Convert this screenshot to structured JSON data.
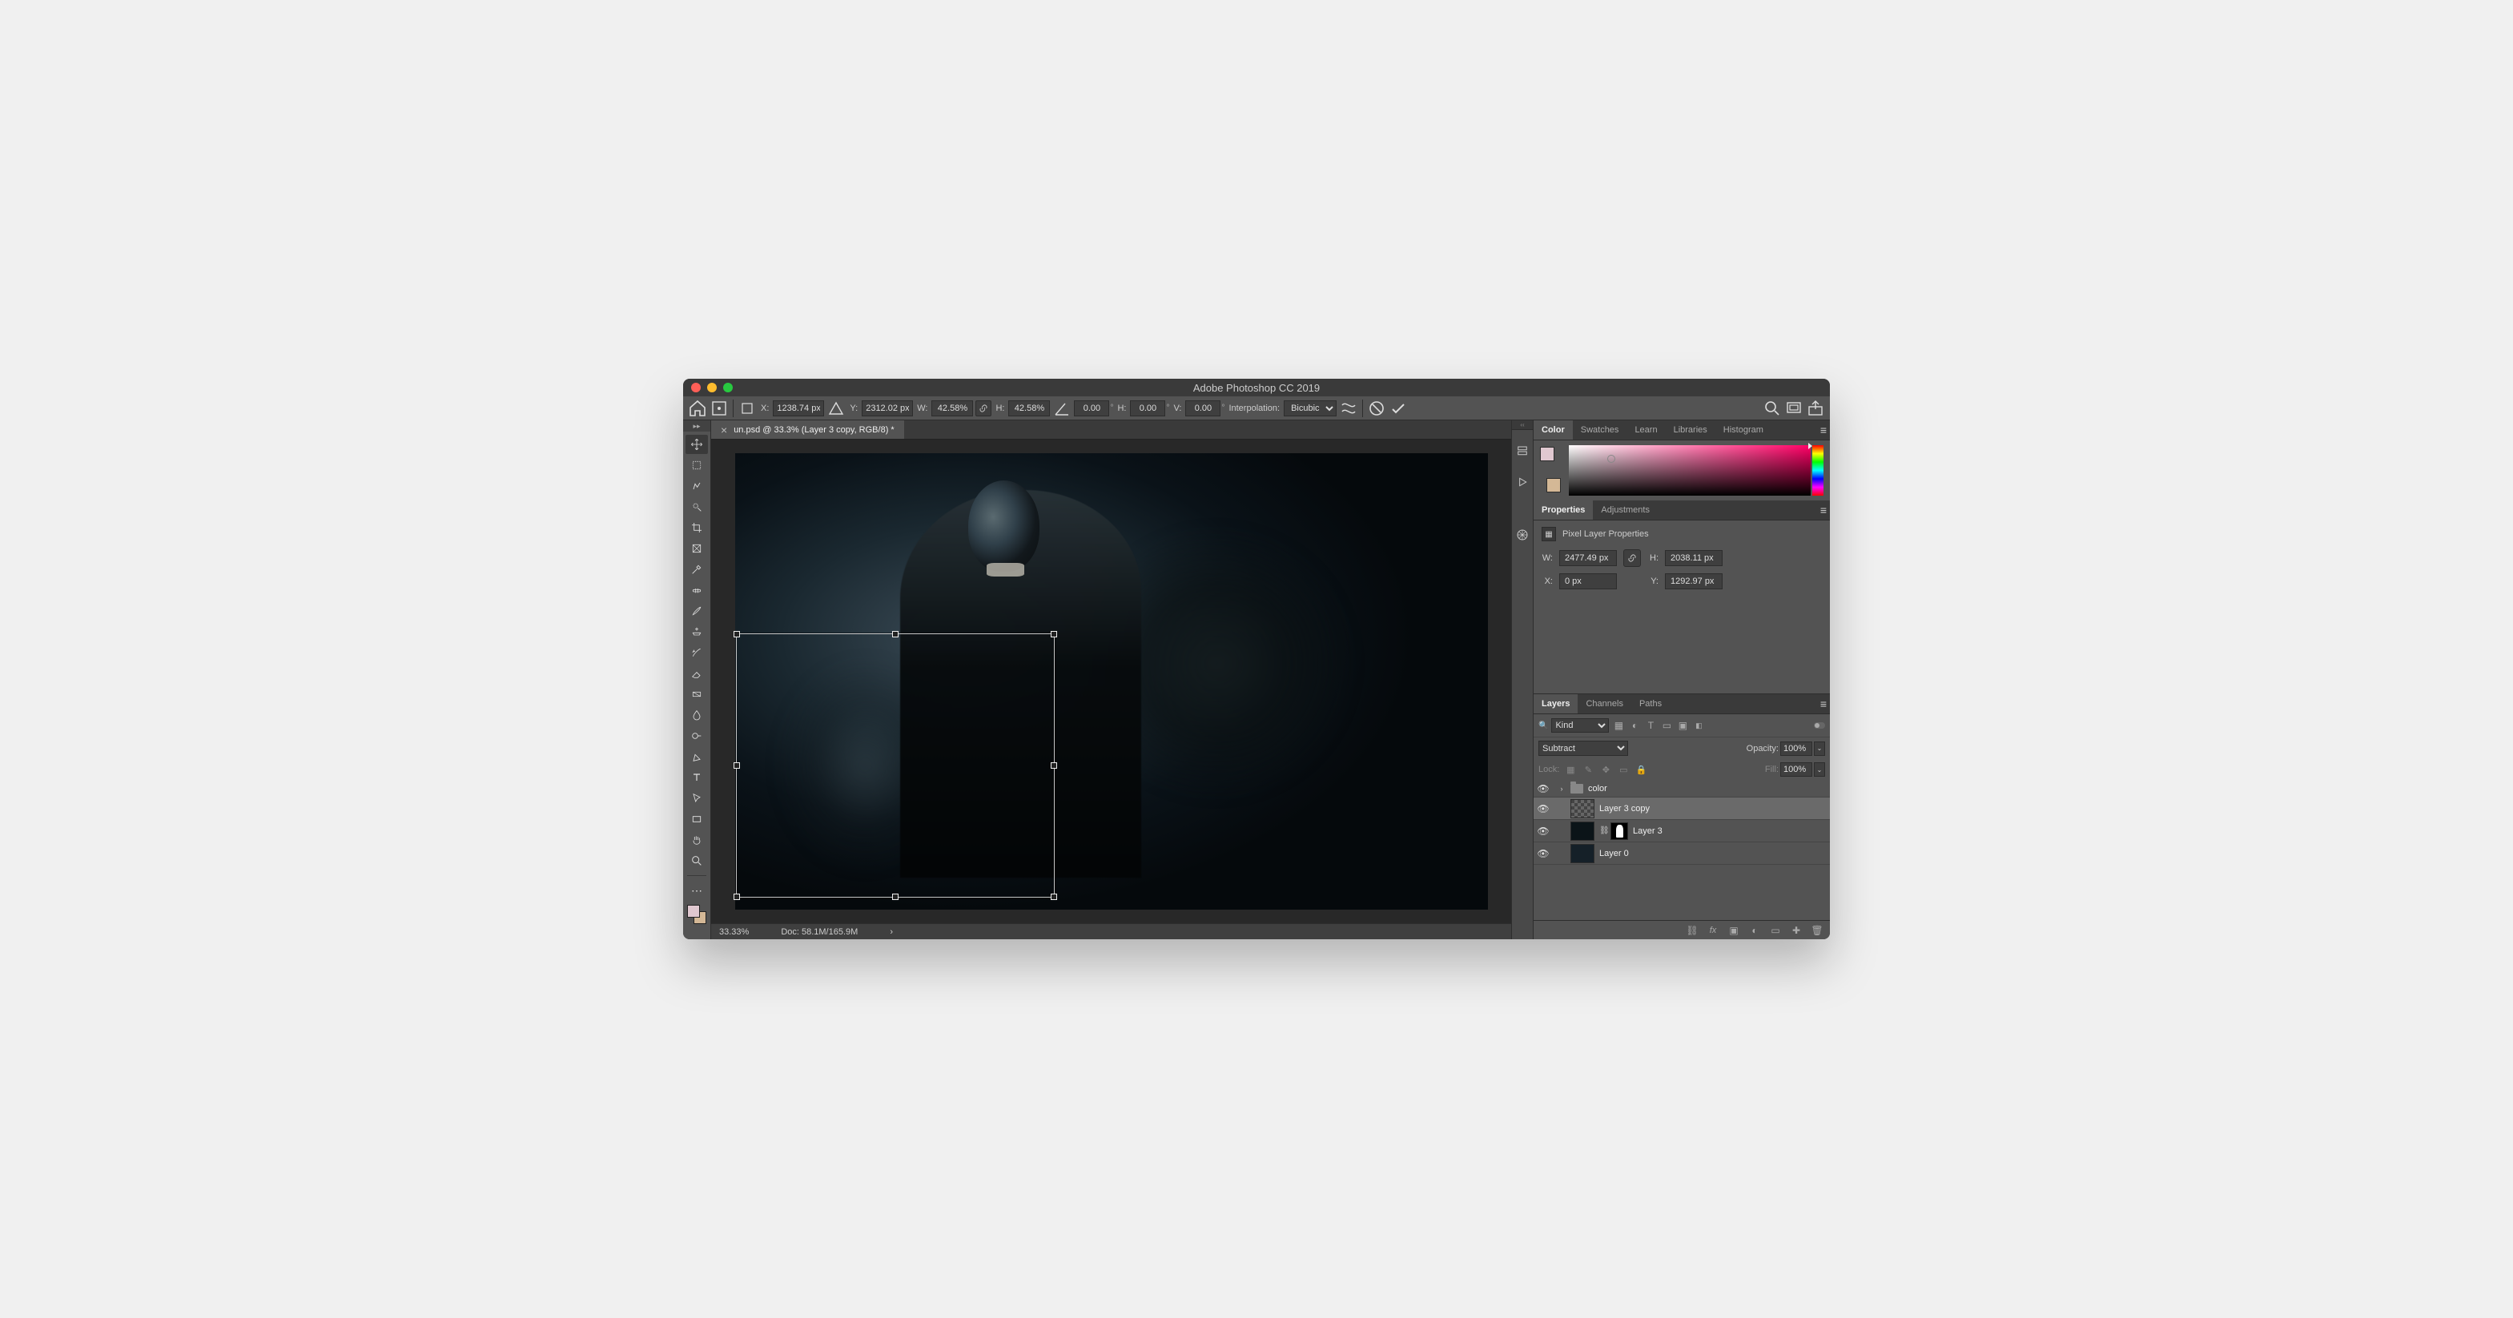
{
  "app_title": "Adobe Photoshop CC 2019",
  "options": {
    "x": "1238.74 px",
    "y": "2312.02 px",
    "w": "42.58%",
    "h": "42.58%",
    "angle": "0.00",
    "skew_h": "0.00",
    "skew_v": "0.00",
    "interp_label": "Interpolation:",
    "interp_value": "Bicubic"
  },
  "options_labels": {
    "x": "X:",
    "y": "Y:",
    "w": "W:",
    "h": "H:",
    "sh": "H:",
    "sv": "V:"
  },
  "doc_tab": "un.psd @ 33.3% (Layer 3 copy, RGB/8) *",
  "status": {
    "zoom": "33.33%",
    "doc": "Doc: 58.1M/165.9M"
  },
  "color_tabs": [
    "Color",
    "Swatches",
    "Learn",
    "Libraries",
    "Histogram"
  ],
  "props_tabs": [
    "Properties",
    "Adjustments"
  ],
  "props_header": "Pixel Layer Properties",
  "props": {
    "w": "2477.49 px",
    "h": "2038.11 px",
    "x": "0 px",
    "y": "1292.97 px"
  },
  "props_labels": {
    "w": "W:",
    "h": "H:",
    "x": "X:",
    "y": "Y:"
  },
  "layers_tabs": [
    "Layers",
    "Channels",
    "Paths"
  ],
  "layers_panel": {
    "filter_kind": "Kind",
    "blend_mode": "Subtract",
    "opacity_label": "Opacity:",
    "opacity": "100%",
    "lock_label": "Lock:",
    "fill_label": "Fill:",
    "fill": "100%"
  },
  "layers": [
    {
      "name": "color",
      "type": "folder"
    },
    {
      "name": "Layer 3 copy",
      "type": "layer",
      "selected": true
    },
    {
      "name": "Layer 3",
      "type": "layer",
      "has_mask": true
    },
    {
      "name": "Layer 0",
      "type": "layer"
    }
  ]
}
